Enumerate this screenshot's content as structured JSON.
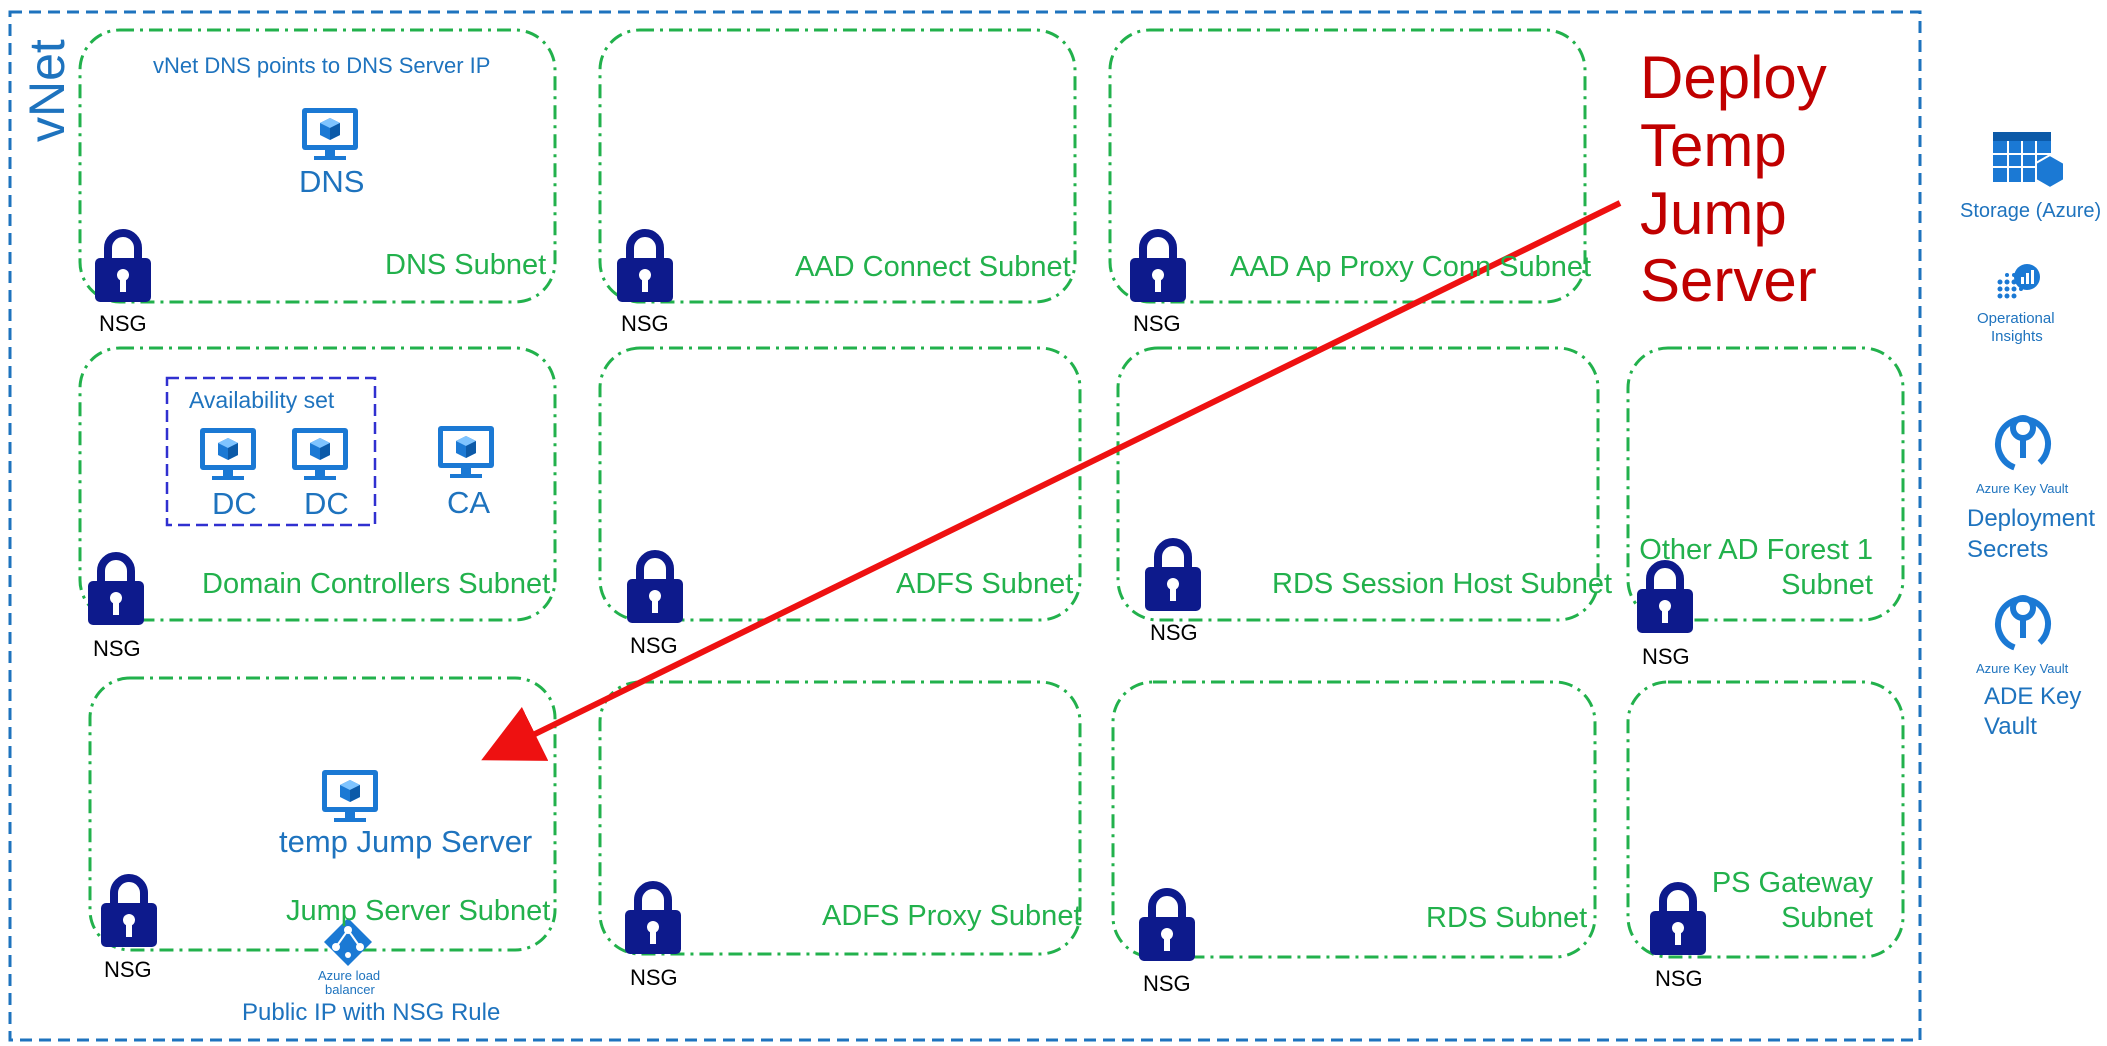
{
  "vnet": {
    "label": "vNet"
  },
  "annotation": {
    "dns_note": "vNet DNS points to DNS Server IP",
    "deploy_lines": [
      "Deploy",
      "Temp",
      "Jump",
      "Server"
    ]
  },
  "subnets": [
    {
      "label": "DNS Subnet"
    },
    {
      "label": "AAD Connect Subnet"
    },
    {
      "label": "AAD Ap Proxy Conn Subnet"
    },
    {
      "label": "Domain Controllers Subnet"
    },
    {
      "label": "ADFS Subnet"
    },
    {
      "label": "RDS Session Host Subnet"
    },
    {
      "label_lines": [
        "Other AD Forest 1",
        "Subnet"
      ]
    },
    {
      "label": "Jump Server Subnet"
    },
    {
      "label": "ADFS Proxy Subnet"
    },
    {
      "label": "RDS Subnet"
    },
    {
      "label_lines": [
        "PS Gateway",
        "Subnet"
      ]
    }
  ],
  "nsg_label": "NSG",
  "vms": {
    "dns": "DNS",
    "dc1": "DC",
    "dc2": "DC",
    "ca": "CA",
    "jump": "temp Jump Server"
  },
  "availability_set": {
    "label": "Availability set"
  },
  "load_balancer": {
    "line1": "Azure load",
    "line2": "balancer",
    "public_ip": "Public IP with NSG Rule"
  },
  "side_panel": {
    "storage": "Storage (Azure)",
    "insights_line1": "Operational",
    "insights_line2": "Insights",
    "key_vault_caption": "Azure Key Vault",
    "deployment_line1": "Deployment",
    "deployment_line2": "Secrets",
    "ade_line1": "ADE Key",
    "ade_line2": "Vault"
  },
  "colors": {
    "vnet_border": "#1e73be",
    "subnet_border": "#22b14c",
    "lock": "#0d1a8c",
    "arrow": "#ee1111",
    "deploy_text": "#c00000",
    "avset_border": "#3030d0"
  }
}
